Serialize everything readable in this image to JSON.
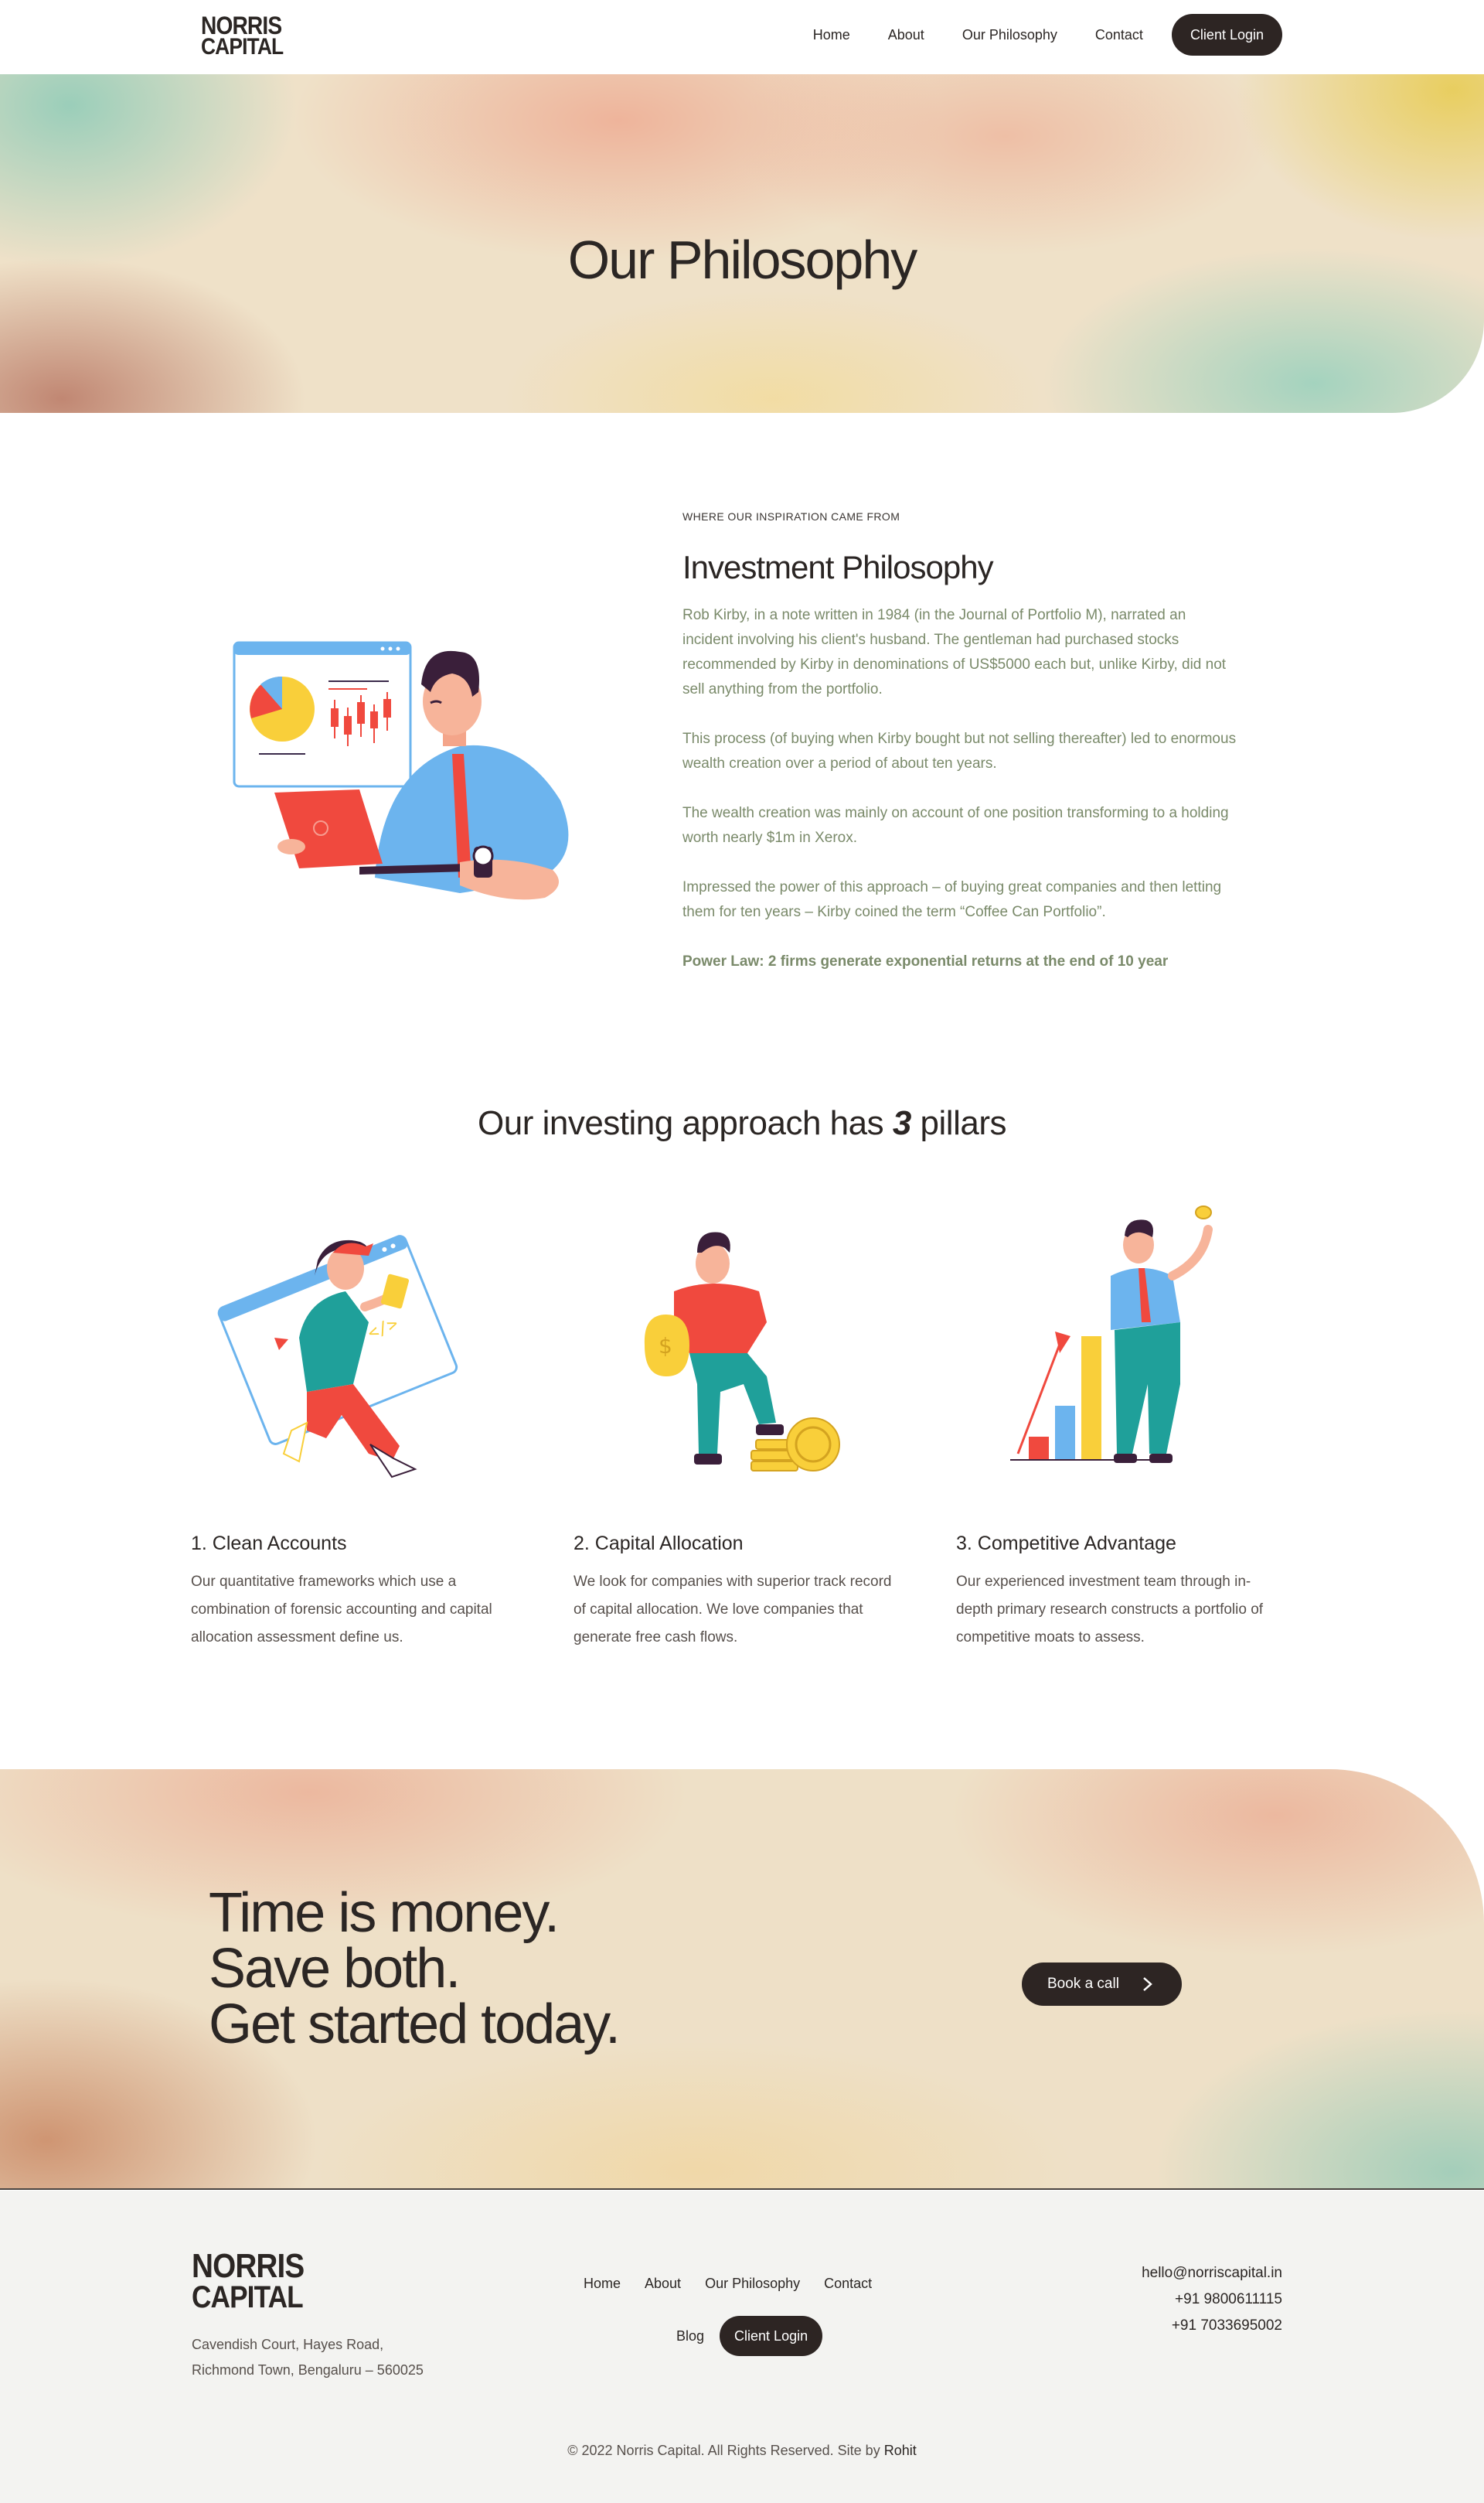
{
  "brand": {
    "line1": "NORRIS",
    "line2": "CAPITAL"
  },
  "nav": {
    "home": "Home",
    "about": "About",
    "philosophy": "Our Philosophy",
    "contact": "Contact",
    "login": "Client Login"
  },
  "hero": {
    "title": "Our Philosophy"
  },
  "philosophy": {
    "eyebrow": "WHERE OUR INSPIRATION CAME FROM",
    "title": "Investment Philosophy",
    "paragraphs": [
      "Rob Kirby, in a note written in 1984 (in the Journal of Portfolio M), narrated an incident involving his client's husband. The gentleman had purchased stocks recommended by Kirby in denominations of US$5000 each but, unlike Kirby, did not sell anything from the portfolio.",
      "This process (of buying when Kirby bought but not selling thereafter) led to enormous wealth creation over a period of about ten years.",
      "The wealth creation was mainly on account of one position transforming to a holding worth nearly $1m in Xerox.",
      "Impressed the power of this approach – of buying great companies and then letting them for ten years – Kirby coined the term “Coffee Can Portfolio”."
    ],
    "highlight": "Power Law: 2 firms generate exponential returns at the end of 10 year"
  },
  "pillars": {
    "title_before": "Our investing approach has ",
    "title_number": "3",
    "title_after": " pillars",
    "items": [
      {
        "title": "1. Clean Accounts",
        "text": "Our quantitative frameworks which use a combination of forensic accounting and capital allocation assessment define us."
      },
      {
        "title": "2. Capital Allocation",
        "text": "We look for companies with superior track record of capital allocation. We love companies that generate free cash flows."
      },
      {
        "title": "3. Competitive Advantage",
        "text": "Our experienced investment team through in-depth primary research constructs a portfolio of competitive moats to assess."
      }
    ]
  },
  "cta": {
    "line1": "Time is money.",
    "line2": "Save both.",
    "line3": "Get started today.",
    "button": "Book a call"
  },
  "footer": {
    "address_line1": "Cavendish Court, Hayes Road,",
    "address_line2": "Richmond Town, Bengaluru – 560025",
    "nav": {
      "home": "Home",
      "about": "About",
      "philosophy": "Our Philosophy",
      "contact": "Contact",
      "blog": "Blog",
      "login": "Client Login"
    },
    "email": "hello@norriscapital.in",
    "phone1": "+91 9800611115",
    "phone2": "+91 7033695002",
    "copyright": "© 2022 Norris Capital. All Rights Reserved. Site by ",
    "credit": "Rohit"
  },
  "colors": {
    "dark": "#2d2523",
    "green_text": "#7a8a6a",
    "accent_red": "#f0493e",
    "accent_blue": "#6cb4ee",
    "accent_yellow": "#f9cf3a",
    "accent_teal": "#1fa09a"
  }
}
